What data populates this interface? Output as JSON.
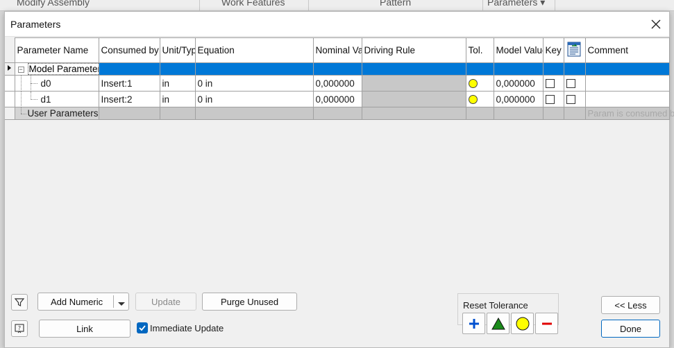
{
  "ribbon": {
    "tabs": [
      "Modify Assembly",
      "Work Features",
      "Pattern",
      "Parameters ▾"
    ]
  },
  "dialog": {
    "title": "Parameters"
  },
  "columns": {
    "name": "Parameter Name",
    "consumed": "Consumed by",
    "unit": "Unit/Type",
    "equation": "Equation",
    "nominal": "Nominal Value",
    "driving": "Driving Rule",
    "tol": "Tol.",
    "model": "Model Value",
    "key": "Key",
    "comment": "Comment"
  },
  "groups": {
    "model": "Model Parameters",
    "user": "User Parameters"
  },
  "rows": [
    {
      "name": "d0",
      "consumed": "Insert:1",
      "unit": "in",
      "equation": "0 in",
      "nominal": "0,000000",
      "model": "0,000000"
    },
    {
      "name": "d1",
      "consumed": "Insert:2",
      "unit": "in",
      "equation": "0 in",
      "nominal": "0,000000",
      "model": "0,000000"
    }
  ],
  "ghost_text": "Param is consumed by",
  "buttons": {
    "add_numeric": "Add Numeric",
    "update": "Update",
    "purge": "Purge Unused",
    "link": "Link",
    "immediate_update": "Immediate Update",
    "less": "<< Less",
    "done": "Done"
  },
  "reset_tolerance": {
    "label": "Reset Tolerance"
  },
  "colors": {
    "selection": "#0078d7",
    "tolerance_yellow": "#ffff00",
    "plus_blue": "#0050d0",
    "triangle_green": "#1a8a1a",
    "minus_red": "#e00000",
    "done_border": "#0067c0"
  }
}
